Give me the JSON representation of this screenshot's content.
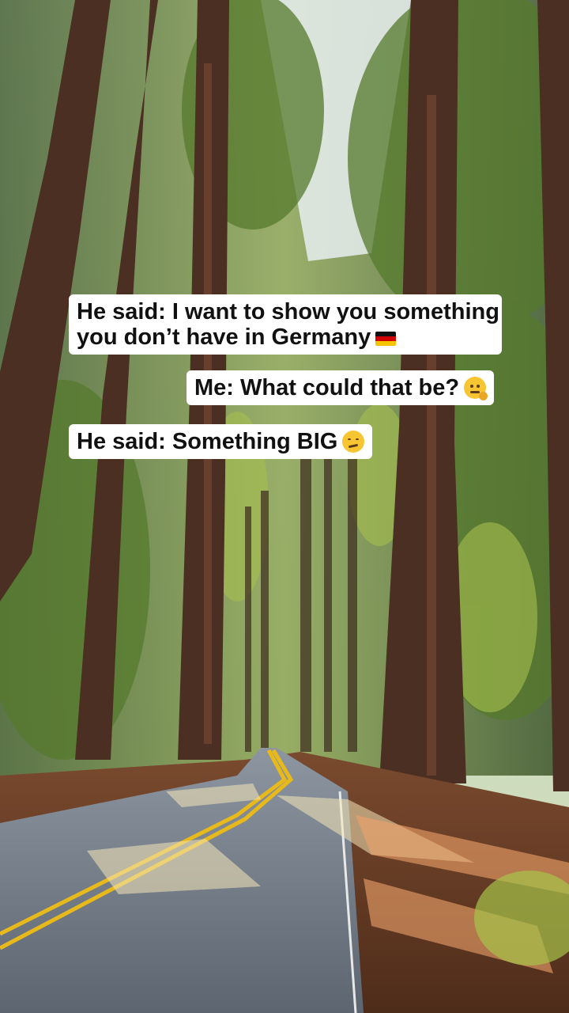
{
  "captions": {
    "line1a": "He said: I want to show you something",
    "line1b": "you don’t have in Germany",
    "line2": "Me: What could that be?",
    "line3": "He said: Something BIG"
  },
  "icons": {
    "flag": "germany-flag-icon",
    "thinking": "thinking-face-icon",
    "smirk": "smirking-face-icon"
  },
  "colors": {
    "caption_bg": "#ffffff",
    "caption_text": "#111111",
    "road_line": "#e8b91a"
  }
}
